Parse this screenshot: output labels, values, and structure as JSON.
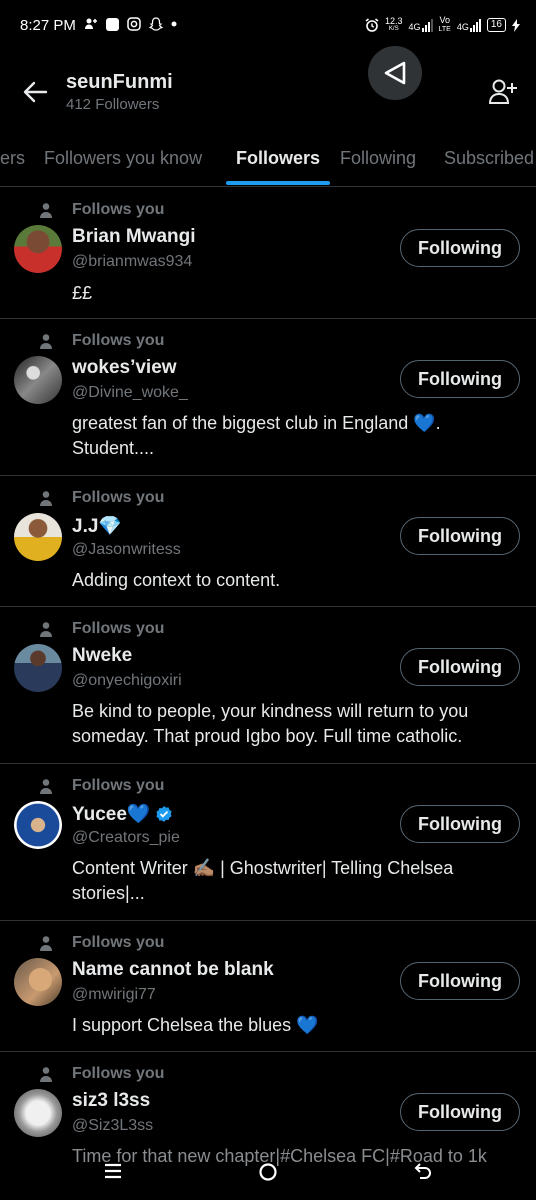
{
  "status_bar": {
    "time": "8:27 PM",
    "net_speed": "12.3",
    "net_speed_unit": "K/S",
    "net1": "4G",
    "net2_top": "Vo",
    "net2_bottom": "LTE",
    "net3": "4G",
    "battery": "16"
  },
  "header": {
    "title": "seunFunmi",
    "subtitle": "412 Followers"
  },
  "tabs": [
    {
      "label": "ers"
    },
    {
      "label": "Followers you know"
    },
    {
      "label": "Followers"
    },
    {
      "label": "Following"
    },
    {
      "label": "Subscribed"
    }
  ],
  "active_tab": "Followers",
  "follows_you_label": "Follows you",
  "following_button_label": "Following",
  "users": [
    {
      "name": "Brian Mwangi",
      "handle": "@brianmwas934",
      "bio": "££"
    },
    {
      "name": "wokes’view",
      "handle": "@Divine_woke_",
      "bio": "greatest fan of the biggest club in England 💙. Student...."
    },
    {
      "name": "J.J💎",
      "handle": "@Jasonwritess",
      "bio": "Adding context to content."
    },
    {
      "name": "Nweke",
      "handle": "@onyechigoxiri",
      "bio": "Be kind to people, your kindness will return to you someday. That proud Igbo boy. Full time catholic."
    },
    {
      "name": "Yucee💙",
      "handle": "@Creators_pie",
      "bio": "Content Writer ✍🏽 | Ghostwriter| Telling Chelsea stories|..."
    },
    {
      "name": "Name cannot be blank",
      "handle": "@mwirigi77",
      "bio": "I support Chelsea the blues 💙"
    },
    {
      "name": "siz3 l3ss",
      "handle": "@Siz3L3ss",
      "bio": "Time for that new chapter|#Chelsea FC|#Road to 1k"
    }
  ],
  "colors": {
    "background": "#000000",
    "primary_text": "#e7e9ea",
    "secondary_text": "#71767b",
    "accent": "#1d9bf0",
    "divider": "#2f3336"
  },
  "icons": [
    "back-arrow-icon",
    "navigate-back-icon",
    "add-user-icon",
    "person-icon",
    "verified-badge-icon",
    "menu-icon",
    "home-icon",
    "back-icon"
  ]
}
